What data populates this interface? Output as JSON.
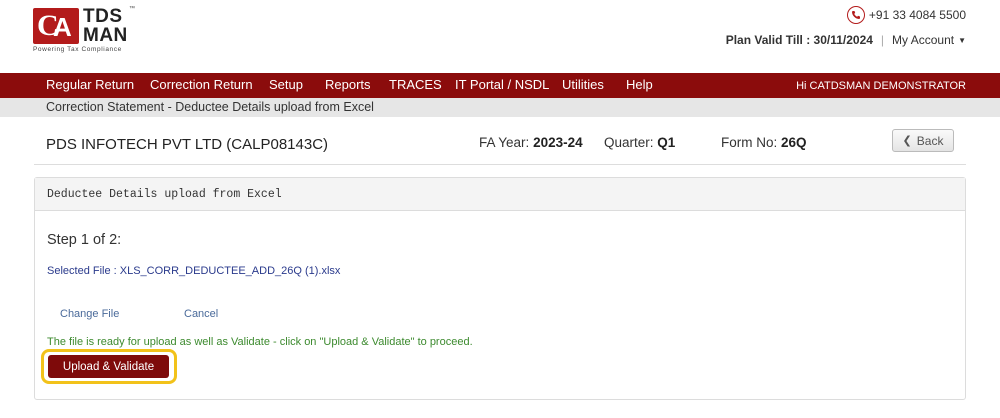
{
  "logo": {
    "mark_c": "C",
    "mark_a": "A",
    "line1": "TDS",
    "line2": "MAN",
    "tagline": "Powering Tax Compliance",
    "trademark": "™"
  },
  "header": {
    "phone": "+91 33 4084 5500",
    "plan": "Plan Valid Till : 30/11/2024",
    "separator": "|",
    "my_account": "My Account"
  },
  "nav": {
    "items": [
      "Regular Return",
      "Correction Return",
      "Setup",
      "Reports",
      "TRACES",
      "IT Portal / NSDL",
      "Utilities",
      "Help"
    ],
    "user_greeting": "Hi CATDSMAN DEMONSTRATOR"
  },
  "breadcrumb": "Correction Statement - Deductee Details upload from Excel",
  "info": {
    "company": "PDS INFOTECH PVT LTD (CALP08143C)",
    "fa_year_label": "FA Year:",
    "fa_year": "2023-24",
    "quarter_label": "Quarter:",
    "quarter": "Q1",
    "form_label": "Form No:",
    "form": "26Q",
    "back": "Back"
  },
  "panel": {
    "heading": "Deductee Details upload from Excel",
    "step": "Step 1 of 2:",
    "selected_file": "Selected File : XLS_CORR_DEDUCTEE_ADD_26Q (1).xlsx",
    "change_file": "Change File",
    "cancel": "Cancel",
    "ready_msg": "The file is ready for upload as well as Validate - click on \"Upload & Validate\" to proceed.",
    "upload_button": "Upload & Validate"
  },
  "colors": {
    "brand_red": "#8b0c0c",
    "highlight": "#f2c21a",
    "success_text": "#3c8a2e"
  }
}
